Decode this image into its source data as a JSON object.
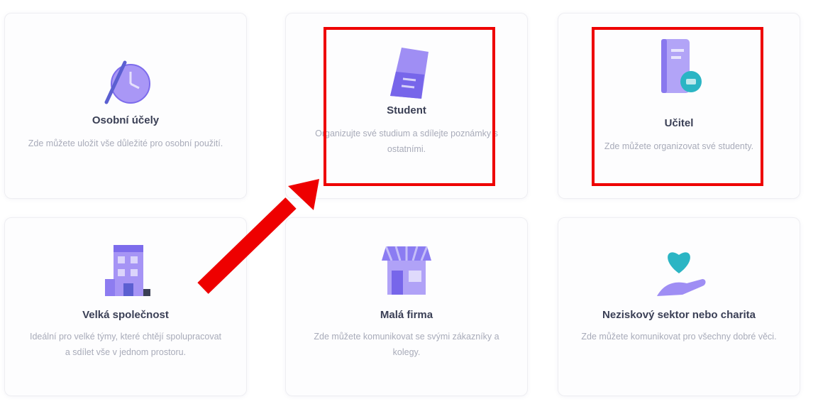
{
  "cards": [
    {
      "title": "Osobní účely",
      "desc": "Zde můžete uložit vše důležité pro osobní použití."
    },
    {
      "title": "Student",
      "desc": "Organizujte své studium a sdílejte poznámky s ostatními."
    },
    {
      "title": "Učitel",
      "desc": "Zde můžete organizovat své studenty."
    },
    {
      "title": "Velká společnost",
      "desc": "Ideální pro velké týmy, které chtějí spolupracovat a sdílet vše v jednom prostoru."
    },
    {
      "title": "Malá firma",
      "desc": "Zde můžete komunikovat se svými zákazníky a kolegy."
    },
    {
      "title": "Neziskový sektor nebo charita",
      "desc": "Zde můžete komunikovat pro všechny dobré věci."
    }
  ],
  "colors": {
    "highlight": "#ee0000",
    "icon_primary": "#8b7cf2",
    "icon_accent": "#2bb5c4"
  }
}
